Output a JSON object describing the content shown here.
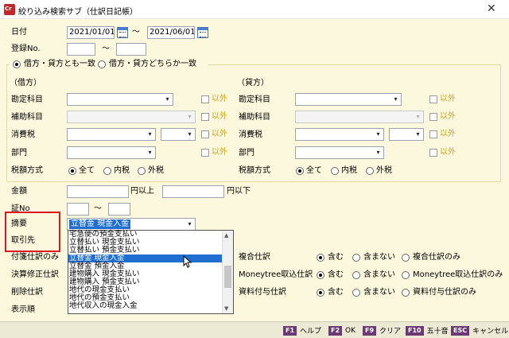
{
  "window": {
    "title": "絞り込み検索サブ（仕訳日記帳）",
    "icon_text": "Cr",
    "close": "✕"
  },
  "date": {
    "label": "日付",
    "from": "2021/01/01",
    "tilde": "～",
    "to": "2021/06/01"
  },
  "reg_no": {
    "label": "登録No.",
    "tilde": "～"
  },
  "match_mode": {
    "option_both": "借方・貸方とも一致",
    "option_either": "借方・貸方どちらか一致",
    "selected": "both"
  },
  "debit": {
    "heading": "（借方）",
    "account": "勘定科目",
    "sub_account": "補助科目",
    "tax": "消費税",
    "department": "部門",
    "tax_method": "税額方式"
  },
  "credit": {
    "heading": "（貸方）",
    "account": "勘定科目",
    "sub_account": "補助科目",
    "tax": "消費税",
    "department": "部門",
    "tax_method": "税額方式"
  },
  "except_label": "以外",
  "tax_options": {
    "all": "全て",
    "inclusive": "内税",
    "exclusive": "外税",
    "selected": "all"
  },
  "amount": {
    "label": "金額",
    "from_suffix": "円以上",
    "to_suffix": "円以下"
  },
  "voucher_no": {
    "label": "証No",
    "tilde": "～"
  },
  "summary": {
    "label": "摘要",
    "value": "立替金 現金入金"
  },
  "partner": {
    "label": "取引先"
  },
  "left_labels": {
    "sticky": "付箋仕訳のみ",
    "adjust": "決算修正仕訳",
    "deleted": "削除仕訳",
    "order": "表示順"
  },
  "dropdown_items": [
    "宅急便の預金支払い",
    "立替払い 現金支払い",
    "立替払い 預金支払い",
    "立替金 現金入金",
    "立替金 預金入金",
    "建物購入 現金支払い",
    "建物購入 預金支払い",
    "地代の現金支払い",
    "地代の預金支払い",
    "地代収入の現金入金"
  ],
  "dropdown_selected_index": 3,
  "compound": {
    "label": "複合仕訳",
    "include": "含む",
    "exclude": "含まない",
    "only": "複合仕訳のみ"
  },
  "moneytree": {
    "label": "Moneytree取込仕訳",
    "include": "含む",
    "exclude": "含まない",
    "only": "Moneytree取込仕訳のみ"
  },
  "attachment": {
    "label": "資料付与仕訳",
    "include": "含む",
    "exclude": "含まない",
    "only": "資料付与仕訳のみ"
  },
  "fkeys": [
    {
      "key": "F1",
      "label": "ヘルプ"
    },
    {
      "key": "F2",
      "label": "OK"
    },
    {
      "key": "F9",
      "label": "クリア"
    },
    {
      "key": "F10",
      "label": "五十音"
    },
    {
      "key": "ESC",
      "label": "キャンセル"
    }
  ],
  "colors": {
    "window_bg": "#fbf8dd",
    "highlight": "#1e6fd0",
    "except_text": "#c8a21e",
    "annotation_red": "#e0141b",
    "fkey_bg": "#6b3a73"
  }
}
